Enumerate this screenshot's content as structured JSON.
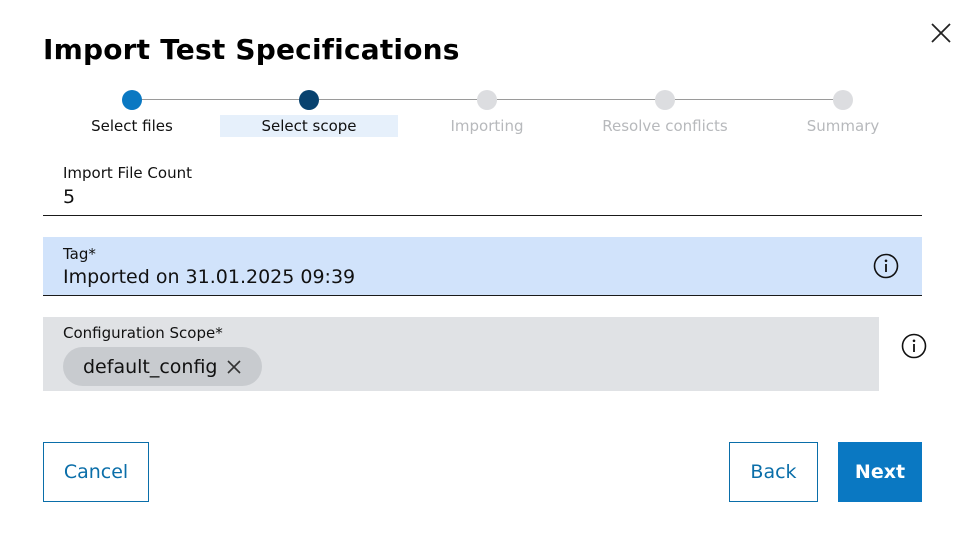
{
  "dialog": {
    "title": "Import Test Specifications"
  },
  "stepper": {
    "steps": [
      {
        "label": "Select files",
        "state": "completed"
      },
      {
        "label": "Select scope",
        "state": "current"
      },
      {
        "label": "Importing",
        "state": "upcoming"
      },
      {
        "label": "Resolve conflicts",
        "state": "upcoming"
      },
      {
        "label": "Summary",
        "state": "upcoming"
      }
    ]
  },
  "fields": {
    "file_count": {
      "label": "Import File Count",
      "value": "5"
    },
    "tag": {
      "label": "Tag*",
      "value": "Imported on 31.01.2025 09:39"
    },
    "scope": {
      "label": "Configuration Scope*",
      "chips": [
        "default_config"
      ]
    }
  },
  "actions": {
    "cancel": "Cancel",
    "back": "Back",
    "next": "Next"
  },
  "colors": {
    "completed_step": "#0a78c2",
    "current_step": "#08426f",
    "upcoming_step": "#dcdde0",
    "upcoming_label": "#b7b9bc",
    "primary": "#0a78c2",
    "tag_bg": "#d1e3fb"
  },
  "icons": {
    "close": "close-icon",
    "info": "info-icon",
    "chip_remove": "remove-chip-icon"
  }
}
